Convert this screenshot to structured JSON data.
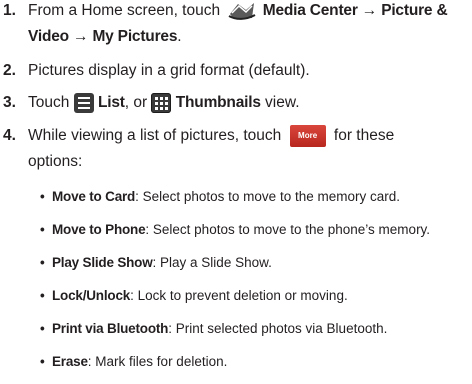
{
  "steps": [
    {
      "number": "1.",
      "pre": "From a Home screen, touch ",
      "icon": "media-center-icon",
      "b1": "Media Center",
      "arrow1": " → ",
      "b2": "Picture &",
      "line2_b1": "Video",
      "arrow2": " → ",
      "line2_b2": "My Pictures",
      "line2_end": "."
    },
    {
      "number": "2.",
      "text": "Pictures display in a grid format (default)."
    },
    {
      "number": "3.",
      "pre": "Touch ",
      "icon1": "list-view-icon",
      "b1": "List",
      "mid": ", or ",
      "icon2": "thumbnails-view-icon",
      "b2": "Thumbnails",
      "post": " view."
    },
    {
      "number": "4.",
      "pre": "While viewing a list of pictures, touch",
      "button": "More",
      "post": "for these",
      "line2": "options:"
    }
  ],
  "options": [
    {
      "term": "Move to Card",
      "desc": ": Select photos to move to the memory card."
    },
    {
      "term": "Move to Phone",
      "desc": ": Select photos to move to the phone’s memory."
    },
    {
      "term": "Play Slide Show",
      "desc": ": Play a Slide Show."
    },
    {
      "term": "Lock/Unlock",
      "desc": ": Lock to prevent deletion or moving."
    },
    {
      "term": "Print via Bluetooth",
      "desc": ": Print selected photos via Bluetooth."
    },
    {
      "term": "Erase",
      "desc": ": Mark files for deletion."
    }
  ],
  "bullet_char": "•"
}
